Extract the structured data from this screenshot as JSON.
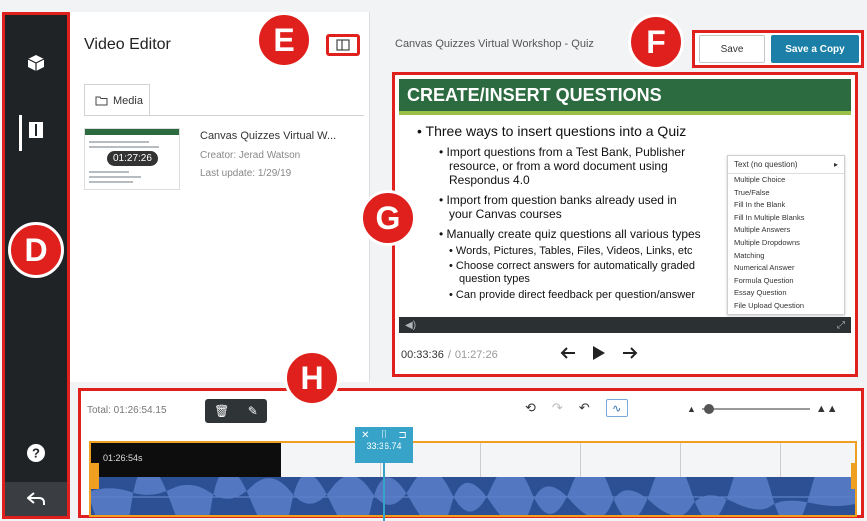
{
  "sidebar": {
    "icons": [
      "cube-icon",
      "panel-icon",
      "help-icon",
      "undo-icon"
    ]
  },
  "media_panel": {
    "title": "Video Editor",
    "tab_label": "Media",
    "item": {
      "thumb_duration": "01:27:26",
      "title": "Canvas Quizzes Virtual W...",
      "creator": "Creator: Jerad Watson",
      "last_update": "Last update: 1/29/19"
    }
  },
  "header": {
    "project_title": "Canvas Quizzes Virtual Workshop - Quiz",
    "save_label": "Save",
    "save_copy_label": "Save a Copy"
  },
  "preview": {
    "slide_title": "CREATE/INSERT QUESTIONS",
    "b1": "Three ways to insert questions into a Quiz",
    "b2a": "Import questions from a Test Bank, Publisher",
    "b2a2": "resource, or from a word document using",
    "b2a3": "Respondus 4.0",
    "b2b": "Import from question banks already used in",
    "b2b2": "your Canvas courses",
    "b2c": "Manually create quiz questions all various types",
    "b3a": "Words, Pictures, Tables, Files, Videos, Links, etc",
    "b3b": "Choose correct answers for automatically graded",
    "b3b2": "question types",
    "b3c": "Can provide direct feedback per question/answer",
    "menu_head": "Text (no question)",
    "menu_items": [
      "Multiple Choice",
      "True/False",
      "Fill In the Blank",
      "Fill In Multiple Blanks",
      "Multiple Answers",
      "Multiple Dropdowns",
      "Matching",
      "Numerical Answer",
      "Formula Question",
      "Essay Question",
      "File Upload Question"
    ],
    "current_time": "00:33:36",
    "separator": "/",
    "total_time": "01:27:26"
  },
  "timeline": {
    "total": "Total: 01:26:54.15",
    "clip_time": "01:26:54s",
    "playhead_time": "33:36.74"
  },
  "callouts": {
    "d": "D",
    "e": "E",
    "f": "F",
    "g": "G",
    "h": "H"
  }
}
